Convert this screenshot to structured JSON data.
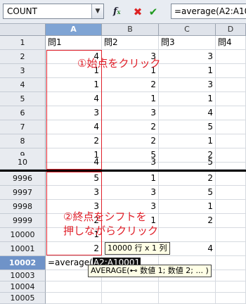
{
  "formula_bar": {
    "name_box": "COUNT",
    "fx_icon": "function-wizard-icon",
    "cancel_icon": "cancel-icon",
    "accept_icon": "accept-icon",
    "formula": "=average(A2:A10001"
  },
  "columns": [
    "A",
    "B",
    "C",
    "D"
  ],
  "upper_rows": [
    {
      "row": "1",
      "cells": [
        "問1",
        "問2",
        "問3",
        "問4"
      ]
    },
    {
      "row": "2",
      "cells": [
        "4",
        "3",
        "3",
        ""
      ]
    },
    {
      "row": "3",
      "cells": [
        "1",
        "1",
        "1",
        ""
      ]
    },
    {
      "row": "4",
      "cells": [
        "1",
        "2",
        "3",
        ""
      ]
    },
    {
      "row": "5",
      "cells": [
        "4",
        "1",
        "1",
        ""
      ]
    },
    {
      "row": "6",
      "cells": [
        "3",
        "3",
        "4",
        ""
      ]
    },
    {
      "row": "7",
      "cells": [
        "4",
        "2",
        "5",
        ""
      ]
    },
    {
      "row": "8",
      "cells": [
        "2",
        "2",
        "1",
        ""
      ]
    },
    {
      "row": "9",
      "cells": [
        "1",
        "5",
        "2",
        ""
      ]
    },
    {
      "row": "10",
      "cells": [
        "4",
        "3",
        "5",
        ""
      ]
    }
  ],
  "lower_rows": [
    {
      "row": "9996",
      "cells": [
        "5",
        "1",
        "2",
        ""
      ]
    },
    {
      "row": "9997",
      "cells": [
        "3",
        "3",
        "5",
        ""
      ]
    },
    {
      "row": "9998",
      "cells": [
        "3",
        "3",
        "1",
        ""
      ]
    },
    {
      "row": "9999",
      "cells": [
        "2",
        "1",
        "2",
        ""
      ]
    },
    {
      "row": "10000",
      "cells": [
        "1",
        "",
        "",
        ""
      ]
    },
    {
      "row": "10001",
      "cells": [
        "2",
        "",
        "4",
        ""
      ]
    },
    {
      "row": "10002",
      "cells": [
        "",
        "",
        "",
        ""
      ]
    },
    {
      "row": "10003",
      "cells": [
        "",
        "",
        "",
        ""
      ]
    },
    {
      "row": "10004",
      "cells": [
        "",
        "",
        "",
        ""
      ]
    },
    {
      "row": "10005",
      "cells": [
        "",
        "",
        "",
        ""
      ]
    }
  ],
  "editing_cell": {
    "prefix": "=average(",
    "reference": "A2:A10001"
  },
  "tooltips": {
    "selection_size": "10000 行 x 1 列",
    "function_hint": "AVERAGE(⊷ 数値 1; 数値 2; ... )"
  },
  "annotations": {
    "start_point": "①始点をクリック",
    "end_point_line1": "②終点をシフトを",
    "end_point_line2": "押しながらクリック"
  },
  "colors": {
    "annotation": "#e0202a",
    "selected_header": "#7fa4d4",
    "active_row_header": "#6f93c8"
  }
}
